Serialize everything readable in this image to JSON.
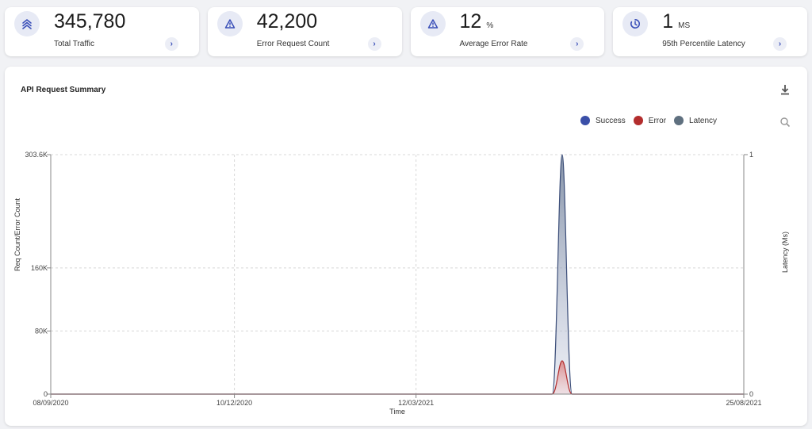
{
  "cards": [
    {
      "id": "total-traffic",
      "icon": "chevrons-up-icon",
      "value": "345,780",
      "unit": "",
      "label": "Total Traffic"
    },
    {
      "id": "error-request-count",
      "icon": "warning-triangle-icon",
      "value": "42,200",
      "unit": "",
      "label": "Error Request Count"
    },
    {
      "id": "average-error-rate",
      "icon": "warning-triangle-icon",
      "value": "12",
      "unit": "%",
      "label": "Average Error Rate"
    },
    {
      "id": "latency",
      "icon": "clock-icon",
      "value": "1",
      "unit": "MS",
      "label": "95th Percentile Latency"
    }
  ],
  "panel": {
    "title": "API Request Summary"
  },
  "colors": {
    "success": "#3a4fa8",
    "error": "#b32d2d",
    "latency": "#5f707f",
    "accent": "#3a4fb8"
  },
  "chart_data": {
    "type": "area",
    "title": "",
    "xlabel": "Time",
    "ylabel": "Req Count/Error Count",
    "y2label": "Latency (Ms)",
    "x_ticks": [
      "08/09/2020",
      "10/12/2020",
      "12/03/2021",
      "25/08/2021"
    ],
    "y_ticks": [
      "0",
      "80K",
      "160K",
      "303.6K"
    ],
    "y_tick_values": [
      0,
      80000,
      160000,
      303600
    ],
    "y2_ticks": [
      "0",
      "1"
    ],
    "ylim": [
      0,
      303600
    ],
    "y2lim": [
      0,
      1
    ],
    "xlim": [
      "08/09/2020",
      "25/08/2021"
    ],
    "grid": true,
    "legend_position": "top-right",
    "legend": [
      "Success",
      "Error",
      "Latency"
    ],
    "series": [
      {
        "name": "Success",
        "x": [
          "08/09/2020",
          "20/05/2021",
          "25/05/2021",
          "30/05/2021",
          "25/08/2021"
        ],
        "values": [
          0,
          0,
          303600,
          0,
          0
        ]
      },
      {
        "name": "Error",
        "x": [
          "08/09/2020",
          "20/05/2021",
          "25/05/2021",
          "30/05/2021",
          "25/08/2021"
        ],
        "values": [
          0,
          0,
          42200,
          0,
          0
        ]
      }
    ]
  }
}
